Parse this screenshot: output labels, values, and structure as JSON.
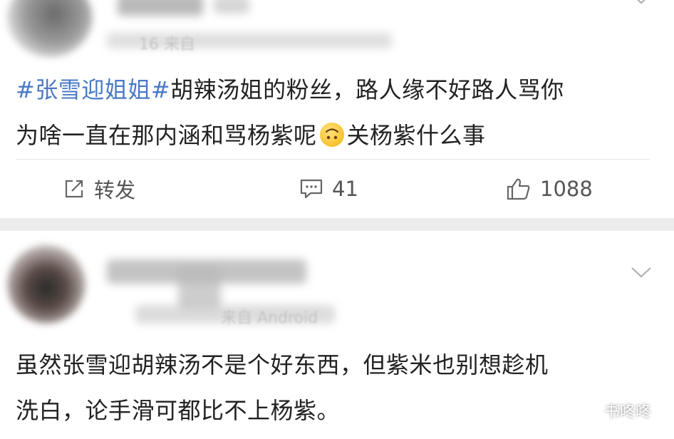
{
  "post1": {
    "meta_blurred": "16 来自",
    "hashtag": "#张雪迎姐姐#",
    "text_line1": "胡辣汤姐的粉丝，路人缘不好路人骂你",
    "text_line2a": "为啥一直在那内涵和骂杨紫呢",
    "emoji": "upside-down-face-icon",
    "text_line2b": "关杨紫什么事",
    "actions": {
      "repost_label": "转发",
      "comment_count": "41",
      "like_count": "1088"
    }
  },
  "post2": {
    "meta_blurred": "来自 Android",
    "text_line1": "虽然张雪迎胡辣汤不是个好东西，但紫米也别想趁机",
    "text_line2": "洗白，论手滑可都比不上杨紫。"
  },
  "watermark": {
    "label": "书咚咚",
    "icon": "wechat-icon"
  },
  "colors": {
    "hashtag": "#4a7ac6",
    "separator": "#ececec",
    "action_text": "#555555"
  }
}
